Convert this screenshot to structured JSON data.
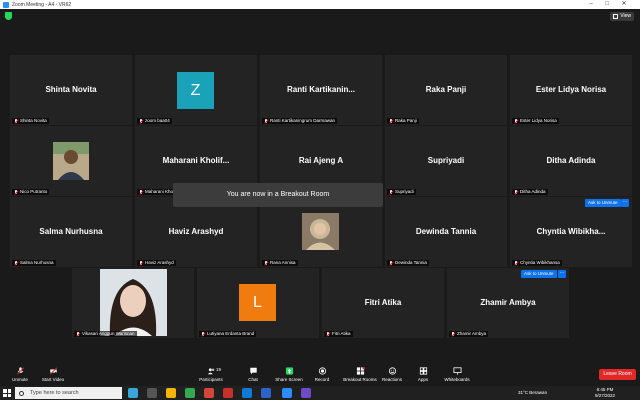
{
  "window": {
    "title": "Zoom Meeting - A4 - VR62",
    "min_label": "–",
    "max_label": "□",
    "close_label": "✕"
  },
  "topbar": {
    "view_label": "View",
    "security_icon": "shield-icon"
  },
  "tiles": [
    {
      "name": "Shinta Novita",
      "label": "Shinta Novita"
    },
    {
      "avatar_letter": "Z",
      "avatar_color": "#1aa3b8",
      "label": "zoom baa04"
    },
    {
      "name": "Ranti  Kartikanin...",
      "label": "Ranti Kartikaningrum Darmawan"
    },
    {
      "name": "Raka Panji",
      "label": "Raka Panji"
    },
    {
      "name": "Ester Lidya Norisa",
      "label": "Ester Lidya Norisa"
    },
    {
      "label": "Nico Putranto"
    },
    {
      "name": "Maharani  Kholif...",
      "label": "Maharani Kholif"
    },
    {
      "name": "Rai Ajeng A",
      "label": ""
    },
    {
      "name": "Supriyadi",
      "label": "Supriyadi"
    },
    {
      "name": "Ditha Adinda",
      "label": "Ditha Adinda"
    },
    {
      "name": "Salma Nurhusna",
      "label": "Salma Nurhusna"
    },
    {
      "name": "Haviz Arashyd",
      "label": "Haviz Arashyd"
    },
    {
      "label": "Rana Annisa"
    },
    {
      "name": "Dewinda Tannia",
      "label": "Dewinda Tannia"
    },
    {
      "name": "Chyntia  Wibikha...",
      "label": "Chyntia Wibikhansa"
    },
    {
      "label": "Vikasari Anggun Warisnan"
    },
    {
      "avatar_letter": "L",
      "avatar_color": "#f07c10",
      "label": "Lutiyana Erdanta Brand"
    },
    {
      "name": "Fitri Atika",
      "label": "Fitri Atika"
    },
    {
      "name": "Zhamir Ambya",
      "label": "Zhamir Ambya"
    }
  ],
  "ask_unmute_label": "Ask to Unmute",
  "more_label": "···",
  "breakout_message": "You are now in a Breakout Room",
  "toolbar": {
    "unmute": "Unmute",
    "start_video": "Start Video",
    "participants": "Participants",
    "participants_count": "19",
    "chat": "Chat",
    "share_screen": "Share Screen",
    "record": "Record",
    "breakout_rooms": "Breakout Rooms",
    "reactions": "Reactions",
    "apps": "Apps",
    "whiteboards": "Whiteboards",
    "leave": "Leave Room"
  },
  "taskbar": {
    "search_placeholder": "Type here to search",
    "weather": "31°C  Berawan",
    "time": "6:45 PM",
    "date": "9/27/2022"
  },
  "colors": {
    "accent": "#0e72ed",
    "leave": "#e02828",
    "share": "#23d959",
    "badge": "#e02828"
  }
}
